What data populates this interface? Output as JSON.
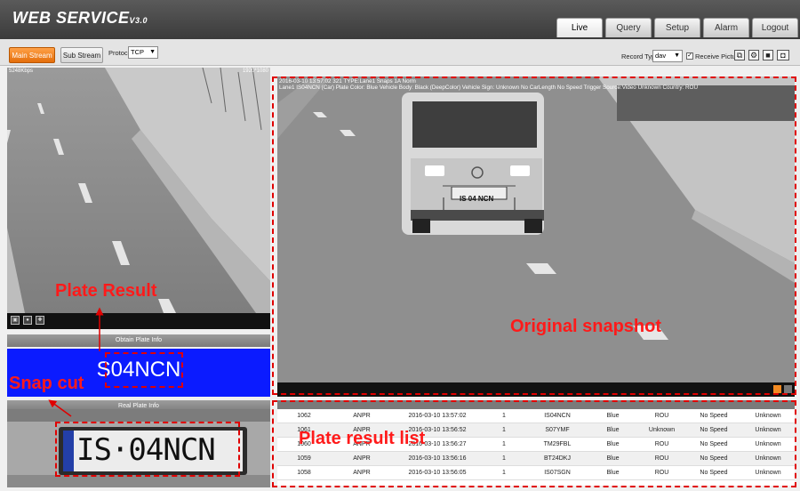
{
  "header": {
    "logo_main": "WEB SERVICE",
    "logo_version": "V3.0",
    "tabs": [
      {
        "label": "Live"
      },
      {
        "label": "Query"
      },
      {
        "label": "Setup"
      },
      {
        "label": "Alarm"
      },
      {
        "label": "Logout"
      }
    ]
  },
  "toolbar": {
    "main_stream": "Main Stream",
    "sub_stream": "Sub Stream",
    "protocol_label": "Protocol",
    "protocol_value": "TCP",
    "record_type_label": "Record Type",
    "record_type_value": "dav",
    "receive_pictures": "Receive Pictures"
  },
  "left_video": {
    "bitrate": "5248Kbps",
    "resolution": "1920*1080"
  },
  "panels": {
    "obtain_plate_info": "Obtain Plate Info",
    "plate_result_value": "S04NCN",
    "real_plate_info": "Real Plate Info",
    "real_plate_text": "IS·04NCN",
    "van_plate_text": "IS 04 NCN"
  },
  "snapshot": {
    "line1": "2016-03-10 13:57:02 321 TYPE:Lane1 Snaps 1A Norm",
    "line2": "Lane1 IS04NCN (Car) Plate Color: Blue Vehicle Body: Black (DeepColor) Vehicle Sign: Unknown No CarLength No Speed Trigger Source:Video Unknown Country: ROU"
  },
  "table": {
    "columns": [
      "",
      "",
      "",
      "",
      "",
      "",
      "",
      "",
      ""
    ],
    "rows": [
      [
        "1062",
        "ANPR",
        "2016-03-10 13:57:02",
        "1",
        "IS04NCN",
        "Blue",
        "ROU",
        "No Speed",
        "Unknown"
      ],
      [
        "1061",
        "ANPR",
        "2016-03-10 13:56:52",
        "1",
        "S07YMF",
        "Blue",
        "Unknown",
        "No Speed",
        "Unknown"
      ],
      [
        "1060",
        "ANPR",
        "2016-03-10 13:56:27",
        "1",
        "TM29FBL",
        "Blue",
        "ROU",
        "No Speed",
        "Unknown"
      ],
      [
        "1059",
        "ANPR",
        "2016-03-10 13:56:16",
        "1",
        "BT24DKJ",
        "Blue",
        "ROU",
        "No Speed",
        "Unknown"
      ],
      [
        "1058",
        "ANPR",
        "2016-03-10 13:56:05",
        "1",
        "IS07SGN",
        "Blue",
        "ROU",
        "No Speed",
        "Unknown"
      ]
    ]
  },
  "annotations": {
    "plate_result": "Plate Result",
    "snap_cut": "Snap cut",
    "original_snapshot": "Original snapshot",
    "plate_result_list": "Plate result list"
  },
  "icons": {
    "sidebar_icons": [
      "screenshot-icon",
      "record-icon",
      "zoom-icon"
    ],
    "toolbar_icons": [
      "capture-icon",
      "settings-icon",
      "snapshot-icon",
      "camera-icon"
    ]
  },
  "colors": {
    "accent_orange": "#f28a22",
    "plate_blue": "#0b1bff",
    "annotation_red": "#ff1a1a"
  }
}
